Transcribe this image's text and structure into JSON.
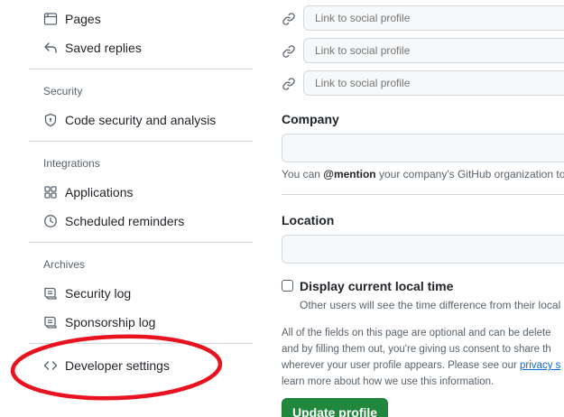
{
  "sidebar": {
    "items_top": [
      {
        "label": "Pages",
        "icon": "browser-icon"
      },
      {
        "label": "Saved replies",
        "icon": "reply-icon"
      }
    ],
    "security": {
      "heading": "Security",
      "items": [
        {
          "label": "Code security and analysis",
          "icon": "shield-lock-icon"
        }
      ]
    },
    "integrations": {
      "heading": "Integrations",
      "items": [
        {
          "label": "Applications",
          "icon": "apps-icon"
        },
        {
          "label": "Scheduled reminders",
          "icon": "clock-icon"
        }
      ]
    },
    "archives": {
      "heading": "Archives",
      "items": [
        {
          "label": "Security log",
          "icon": "log-icon"
        },
        {
          "label": "Sponsorship log",
          "icon": "log-icon"
        }
      ]
    },
    "developer": {
      "label": "Developer settings",
      "icon": "code-icon"
    },
    "highlight_color": "#e8131f"
  },
  "profile": {
    "social_placeholders": [
      "Link to social profile",
      "Link to social profile",
      "Link to social profile"
    ],
    "company": {
      "label": "Company",
      "value": "",
      "note_prefix": "You can ",
      "note_mention": "@mention",
      "note_suffix": " your company's GitHub organization to"
    },
    "location": {
      "label": "Location",
      "value": ""
    },
    "local_time": {
      "label": "Display current local time",
      "checked": false,
      "description": "Other users will see the time difference from their local"
    },
    "disclaimer": {
      "line1": "All of the fields on this page are optional and can be delete",
      "line2": "and by filling them out, you're giving us consent to share th",
      "line3_prefix": "wherever your user profile appears. Please see our ",
      "line3_link": "privacy s",
      "line4": "learn more about how we use this information."
    },
    "update_button": "Update profile"
  }
}
